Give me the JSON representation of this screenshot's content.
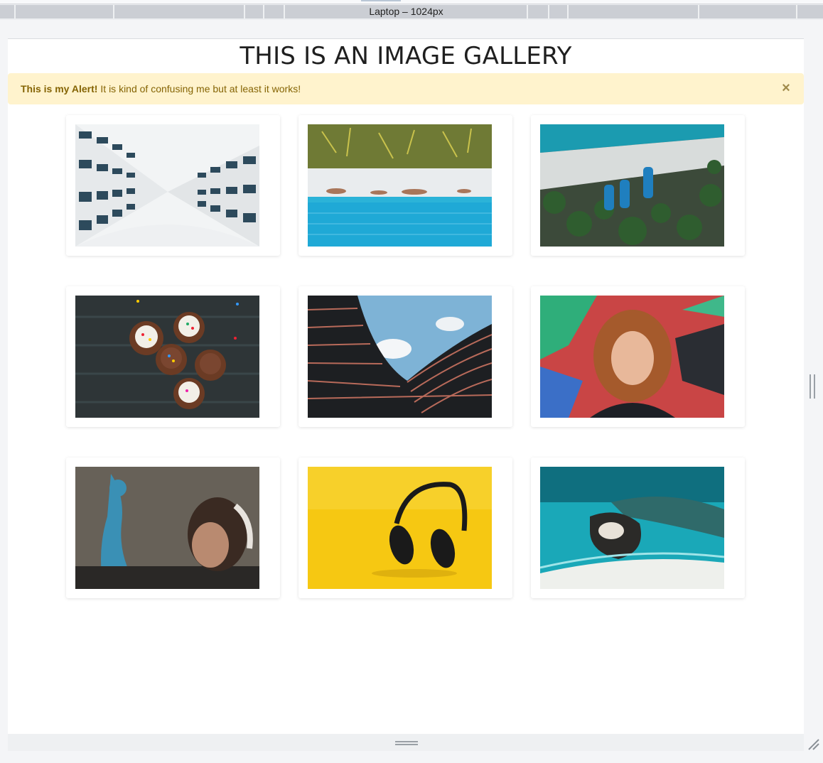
{
  "ruler": {
    "label": "Laptop – 1024px"
  },
  "page": {
    "title": "THIS IS AN IMAGE GALLERY",
    "alert": {
      "strong": "This is my Alert!",
      "message": "It is kind of confusing me but at least it works!",
      "close": "×"
    }
  },
  "gallery": [
    {
      "icon": "architecture-photo"
    },
    {
      "icon": "beach-palms-photo"
    },
    {
      "icon": "boats-beach-photo"
    },
    {
      "icon": "cupcakes-photo"
    },
    {
      "icon": "wavy-building-photo"
    },
    {
      "icon": "girl-graffiti-photo"
    },
    {
      "icon": "graffiti-headphones-photo"
    },
    {
      "icon": "headphones-yellow-photo"
    },
    {
      "icon": "island-aerial-photo"
    }
  ]
}
